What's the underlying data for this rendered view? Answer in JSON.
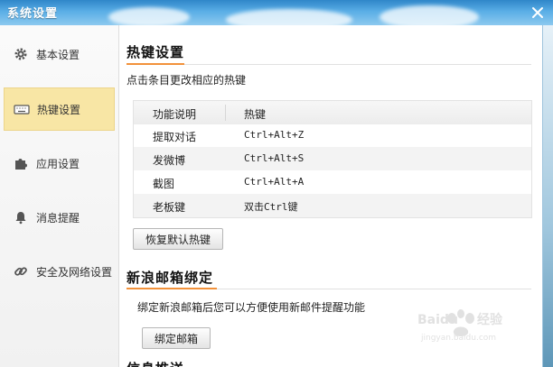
{
  "window": {
    "title": "系统设置"
  },
  "sidebar": {
    "items": [
      {
        "label": "基本设置",
        "icon": "gear-icon"
      },
      {
        "label": "热键设置",
        "icon": "keyboard-icon",
        "active": true
      },
      {
        "label": "应用设置",
        "icon": "puzzle-icon"
      },
      {
        "label": "消息提醒",
        "icon": "bell-icon"
      },
      {
        "label": "安全及网络设置",
        "icon": "link-icon"
      }
    ]
  },
  "hotkeys": {
    "title": "热键设置",
    "hint": "点击条目更改相应的热键",
    "columns": [
      "功能说明",
      "热键"
    ],
    "rows": [
      {
        "function": "提取对话",
        "key": "Ctrl+Alt+Z"
      },
      {
        "function": "发微博",
        "key": "Ctrl+Alt+S"
      },
      {
        "function": "截图",
        "key": "Ctrl+Alt+A"
      },
      {
        "function": "老板键",
        "key": "双击Ctrl键"
      }
    ],
    "restore_label": "恢复默认热键"
  },
  "mail": {
    "title": "新浪邮箱绑定",
    "hint": "绑定新浪邮箱后您可以方便使用新邮件提醒功能",
    "bind_label": "绑定邮箱"
  },
  "next_section": {
    "title": "信息推送"
  },
  "watermark": {
    "brand": "Baidu",
    "sub": "经验",
    "url": "jingyan.baidu.com"
  },
  "colors": {
    "accent": "#f2913a",
    "active_bg": "#f8e6a5",
    "titlebar": "#2f86c9"
  }
}
